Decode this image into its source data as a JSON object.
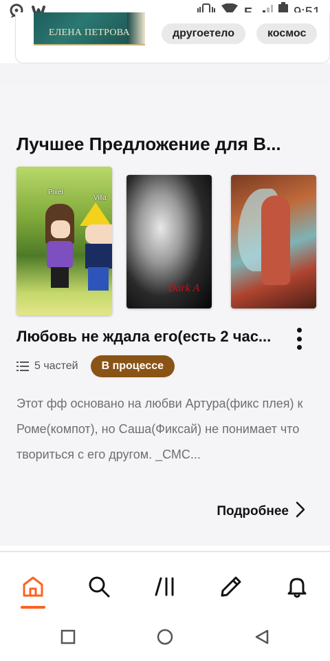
{
  "status_bar": {
    "time": "9:51",
    "network": "E",
    "icons": [
      "chat-icon",
      "wattpad-logo-icon",
      "vibrate-icon",
      "wifi-icon",
      "signal-icon",
      "battery-icon"
    ]
  },
  "previous_card": {
    "cover_text": "ЕЛЕНА ПЕТРОВА",
    "tags": [
      "другоетело",
      "космос"
    ]
  },
  "section": {
    "title": "Лучшее Предложение для В...",
    "covers": [
      {
        "label_a": "Pixel",
        "label_b": "Villa"
      },
      {
        "label": "Dark A"
      },
      {
        "label": ""
      }
    ],
    "story": {
      "title": "Любовь не ждала его(есть 2 час...",
      "parts": "5 частей",
      "status": "В процессе",
      "description": "Этот фф основано на любви Артура(фикс плея) к Роме(компот), но Саша(Фиксай) не понимает что твориться с его другом. _СМС...",
      "details_label": "Подробнее"
    }
  },
  "bottom_nav": {
    "items": [
      "home-icon",
      "search-icon",
      "library-icon",
      "write-icon",
      "notifications-icon"
    ],
    "active": "home-icon"
  },
  "colors": {
    "accent": "#ff6122",
    "status_badge": "#8a5416",
    "background_section": "#f5f4f6"
  }
}
